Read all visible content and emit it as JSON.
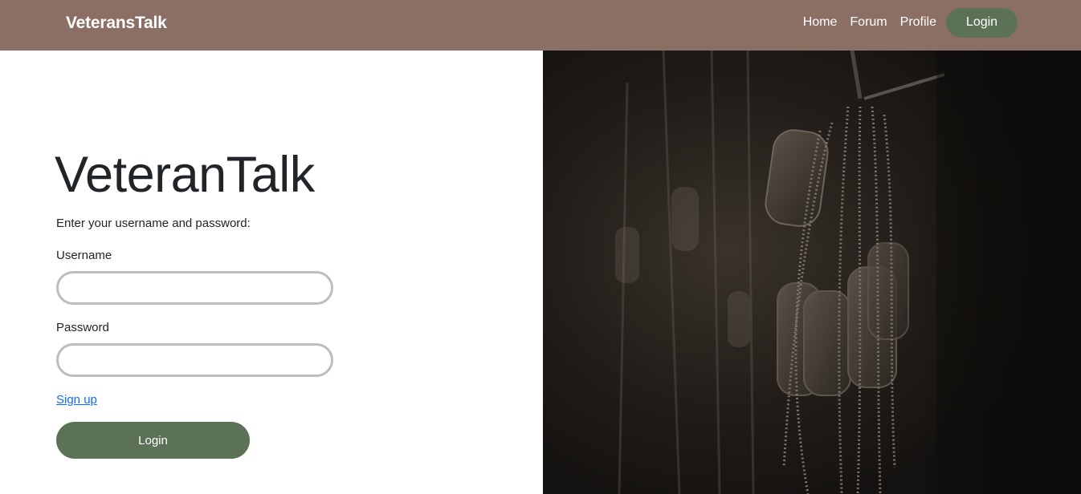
{
  "navbar": {
    "brand": "VeteransTalk",
    "links": [
      "Home",
      "Forum",
      "Profile"
    ],
    "login_label": "Login",
    "background_color": "#8c6f64",
    "button_color": "#5c7256"
  },
  "login_form": {
    "title": "VeteranTalk",
    "subtitle": "Enter your username and password:",
    "username_label": "Username",
    "username_value": "",
    "password_label": "Password",
    "password_value": "",
    "signup_link": "Sign up",
    "submit_label": "Login"
  },
  "hero_image": {
    "subject": "dog-tags-on-chains-photo"
  }
}
